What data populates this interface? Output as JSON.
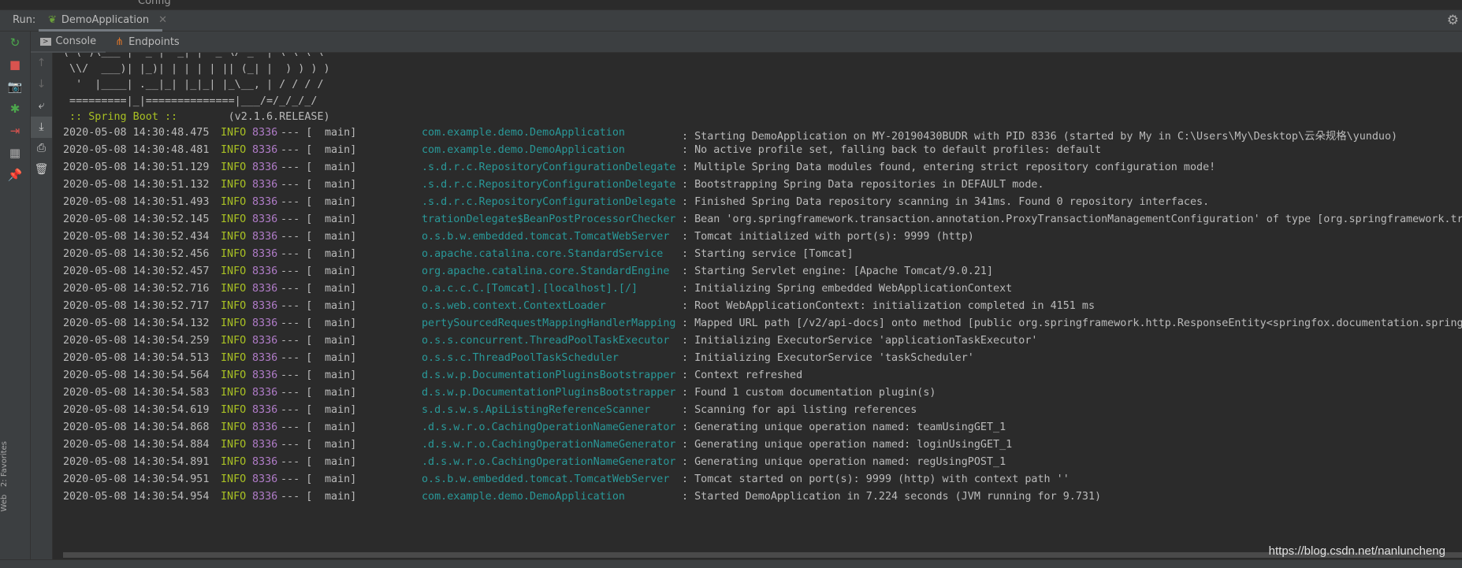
{
  "project_tree_item": "Config",
  "run_label": "Run:",
  "run_tab": {
    "label": "DemoApplication",
    "icon": "spring-boot-icon"
  },
  "console_tabs": [
    {
      "label": "Console",
      "icon": "console-icon"
    },
    {
      "label": "Endpoints",
      "icon": "endpoints-icon"
    }
  ],
  "left_toolbar": [
    "rerun-icon",
    "stop-icon",
    "camera-icon",
    "debug-icon",
    "exit-icon",
    "layout-icon",
    "pin-icon"
  ],
  "second_toolbar": [
    "up-arrow-icon",
    "down-arrow-icon",
    "soft-wrap-icon",
    "scroll-to-end-icon",
    "print-icon",
    "trash-icon"
  ],
  "side_labels": [
    "Web",
    "2: Favorites"
  ],
  "banner": [
    "( ( )\\___ | '_ | '_| | '_ \\/ _` | \\ \\ \\ \\",
    " \\\\/  ___)| |_)| | | | | || (_| |  ) ) ) )",
    "  '  |____| .__|_| |_|_| |_\\__, | / / / /",
    " =========|_|==============|___/=/_/_/_/"
  ],
  "spring_boot_label": " :: Spring Boot :: ",
  "spring_boot_version": "       (v2.1.6.RELEASE)",
  "logs": [
    [
      "2020-05-08 14:30:48.475",
      "INFO",
      "8336",
      "--- [",
      "main]",
      "com.example.demo.DemoApplication",
      ": Starting DemoApplication on MY-20190430BUDR with PID 8336 (started by My in C:\\Users\\My\\Desktop\\云朵规格\\yunduo)"
    ],
    [
      "2020-05-08 14:30:48.481",
      "INFO",
      "8336",
      "--- [",
      "main]",
      "com.example.demo.DemoApplication",
      ": No active profile set, falling back to default profiles: default"
    ],
    [
      "2020-05-08 14:30:51.129",
      "INFO",
      "8336",
      "--- [",
      "main]",
      ".s.d.r.c.RepositoryConfigurationDelegate",
      ": Multiple Spring Data modules found, entering strict repository configuration mode!"
    ],
    [
      "2020-05-08 14:30:51.132",
      "INFO",
      "8336",
      "--- [",
      "main]",
      ".s.d.r.c.RepositoryConfigurationDelegate",
      ": Bootstrapping Spring Data repositories in DEFAULT mode."
    ],
    [
      "2020-05-08 14:30:51.493",
      "INFO",
      "8336",
      "--- [",
      "main]",
      ".s.d.r.c.RepositoryConfigurationDelegate",
      ": Finished Spring Data repository scanning in 341ms. Found 0 repository interfaces."
    ],
    [
      "2020-05-08 14:30:52.145",
      "INFO",
      "8336",
      "--- [",
      "main]",
      "trationDelegate$BeanPostProcessorChecker",
      ": Bean 'org.springframework.transaction.annotation.ProxyTransactionManagementConfiguration' of type [org.springframework.tra"
    ],
    [
      "2020-05-08 14:30:52.434",
      "INFO",
      "8336",
      "--- [",
      "main]",
      "o.s.b.w.embedded.tomcat.TomcatWebServer",
      ": Tomcat initialized with port(s): 9999 (http)"
    ],
    [
      "2020-05-08 14:30:52.456",
      "INFO",
      "8336",
      "--- [",
      "main]",
      "o.apache.catalina.core.StandardService",
      ": Starting service [Tomcat]"
    ],
    [
      "2020-05-08 14:30:52.457",
      "INFO",
      "8336",
      "--- [",
      "main]",
      "org.apache.catalina.core.StandardEngine",
      ": Starting Servlet engine: [Apache Tomcat/9.0.21]"
    ],
    [
      "2020-05-08 14:30:52.716",
      "INFO",
      "8336",
      "--- [",
      "main]",
      "o.a.c.c.C.[Tomcat].[localhost].[/]",
      ": Initializing Spring embedded WebApplicationContext"
    ],
    [
      "2020-05-08 14:30:52.717",
      "INFO",
      "8336",
      "--- [",
      "main]",
      "o.s.web.context.ContextLoader",
      ": Root WebApplicationContext: initialization completed in 4151 ms"
    ],
    [
      "2020-05-08 14:30:54.132",
      "INFO",
      "8336",
      "--- [",
      "main]",
      "pertySourcedRequestMappingHandlerMapping",
      ": Mapped URL path [/v2/api-docs] onto method [public org.springframework.http.ResponseEntity<springfox.documentation.spring."
    ],
    [
      "2020-05-08 14:30:54.259",
      "INFO",
      "8336",
      "--- [",
      "main]",
      "o.s.s.concurrent.ThreadPoolTaskExecutor",
      ": Initializing ExecutorService 'applicationTaskExecutor'"
    ],
    [
      "2020-05-08 14:30:54.513",
      "INFO",
      "8336",
      "--- [",
      "main]",
      "o.s.s.c.ThreadPoolTaskScheduler",
      ": Initializing ExecutorService 'taskScheduler'"
    ],
    [
      "2020-05-08 14:30:54.564",
      "INFO",
      "8336",
      "--- [",
      "main]",
      "d.s.w.p.DocumentationPluginsBootstrapper",
      ": Context refreshed"
    ],
    [
      "2020-05-08 14:30:54.583",
      "INFO",
      "8336",
      "--- [",
      "main]",
      "d.s.w.p.DocumentationPluginsBootstrapper",
      ": Found 1 custom documentation plugin(s)"
    ],
    [
      "2020-05-08 14:30:54.619",
      "INFO",
      "8336",
      "--- [",
      "main]",
      "s.d.s.w.s.ApiListingReferenceScanner",
      ": Scanning for api listing references"
    ],
    [
      "2020-05-08 14:30:54.868",
      "INFO",
      "8336",
      "--- [",
      "main]",
      ".d.s.w.r.o.CachingOperationNameGenerator",
      ": Generating unique operation named: teamUsingGET_1"
    ],
    [
      "2020-05-08 14:30:54.884",
      "INFO",
      "8336",
      "--- [",
      "main]",
      ".d.s.w.r.o.CachingOperationNameGenerator",
      ": Generating unique operation named: loginUsingGET_1"
    ],
    [
      "2020-05-08 14:30:54.891",
      "INFO",
      "8336",
      "--- [",
      "main]",
      ".d.s.w.r.o.CachingOperationNameGenerator",
      ": Generating unique operation named: regUsingPOST_1"
    ],
    [
      "2020-05-08 14:30:54.951",
      "INFO",
      "8336",
      "--- [",
      "main]",
      "o.s.b.w.embedded.tomcat.TomcatWebServer",
      ": Tomcat started on port(s): 9999 (http) with context path ''"
    ],
    [
      "2020-05-08 14:30:54.954",
      "INFO",
      "8336",
      "--- [",
      "main]",
      "com.example.demo.DemoApplication",
      ": Started DemoApplication in 7.224 seconds (JVM running for 9.731)"
    ]
  ],
  "watermark": "https://blog.csdn.net/nanluncheng",
  "colors": {
    "background": "#2b2b2b",
    "panel": "#3c3f41",
    "info": "#a8c023",
    "pid": "#b07cc8",
    "logger": "#299999"
  }
}
